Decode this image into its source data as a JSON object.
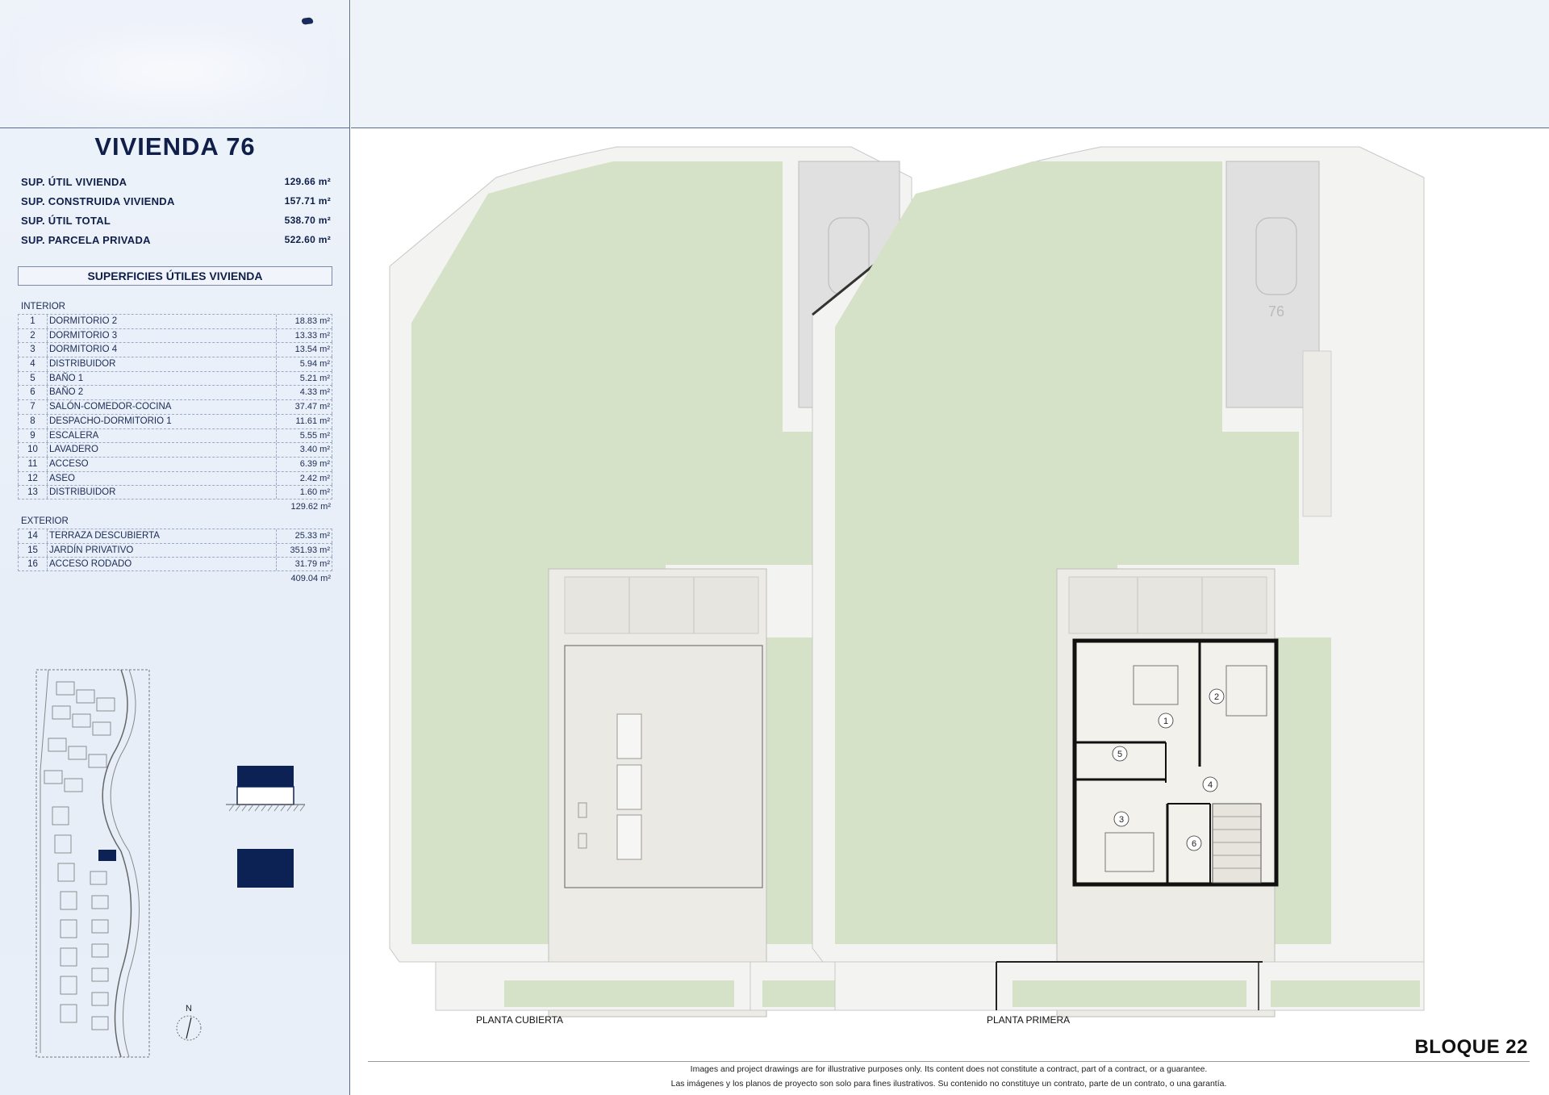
{
  "header": {
    "title": "VIVIENDA 76"
  },
  "summary": [
    {
      "label": "SUP. ÚTIL VIVIENDA",
      "value": "129.66 m²"
    },
    {
      "label": "SUP. CONSTRUIDA VIVIENDA",
      "value": "157.71 m²"
    },
    {
      "label": "SUP. ÚTIL TOTAL",
      "value": "538.70 m²"
    },
    {
      "label": "SUP. PARCELA PRIVADA",
      "value": "522.60 m²"
    }
  ],
  "surfaces": {
    "heading": "SUPERFICIES ÚTILES VIVIENDA",
    "interior_label": "INTERIOR",
    "interior": [
      {
        "num": "1",
        "name": "DORMITORIO 2",
        "value": "18.83 m²"
      },
      {
        "num": "2",
        "name": "DORMITORIO 3",
        "value": "13.33 m²"
      },
      {
        "num": "3",
        "name": "DORMITORIO 4",
        "value": "13.54 m²"
      },
      {
        "num": "4",
        "name": "DISTRIBUIDOR",
        "value": "5.94 m²"
      },
      {
        "num": "5",
        "name": "BAÑO 1",
        "value": "5.21 m²"
      },
      {
        "num": "6",
        "name": "BAÑO 2",
        "value": "4.33 m²"
      },
      {
        "num": "7",
        "name": "SALÓN-COMEDOR-COCINA",
        "value": "37.47 m²"
      },
      {
        "num": "8",
        "name": "DESPACHO-DORMITORIO 1",
        "value": "11.61 m²"
      },
      {
        "num": "9",
        "name": "ESCALERA",
        "value": "5.55 m²"
      },
      {
        "num": "10",
        "name": "LAVADERO",
        "value": "3.40 m²"
      },
      {
        "num": "11",
        "name": "ACCESO",
        "value": "6.39 m²"
      },
      {
        "num": "12",
        "name": "ASEO",
        "value": "2.42 m²"
      },
      {
        "num": "13",
        "name": "DISTRIBUIDOR",
        "value": "1.60 m²"
      }
    ],
    "interior_total": "129.62 m²",
    "exterior_label": "EXTERIOR",
    "exterior": [
      {
        "num": "14",
        "name": "TERRAZA DESCUBIERTA",
        "value": "25.33 m²"
      },
      {
        "num": "15",
        "name": "JARDÍN PRIVATIVO",
        "value": "351.93 m²"
      },
      {
        "num": "16",
        "name": "ACCESO RODADO",
        "value": "31.79 m²"
      }
    ],
    "exterior_total": "409.04 m²"
  },
  "north_label": "N",
  "plans": {
    "left_label": "PLANTA CUBIERTA",
    "right_label": "PLANTA PRIMERA",
    "parking_number": "76",
    "room_numbers": [
      "1",
      "2",
      "3",
      "4",
      "5",
      "6"
    ]
  },
  "footer": {
    "bloque": "BLOQUE 22",
    "disclaimer_en": "Images and project drawings are for illustrative purposes only. Its content does not constitute a contract, part of a contract, or a guarantee.",
    "disclaimer_es": "Las imágenes y los planos de proyecto son solo para fines ilustrativos. Su contenido no constituye un contrato, parte de un contrato, o una garantía."
  },
  "colors": {
    "navy": "#0d2254",
    "garden": "#d5e1c6",
    "paving": "#efede7",
    "parking": "#dedede",
    "sidebar_bg": "#e9eff8"
  }
}
